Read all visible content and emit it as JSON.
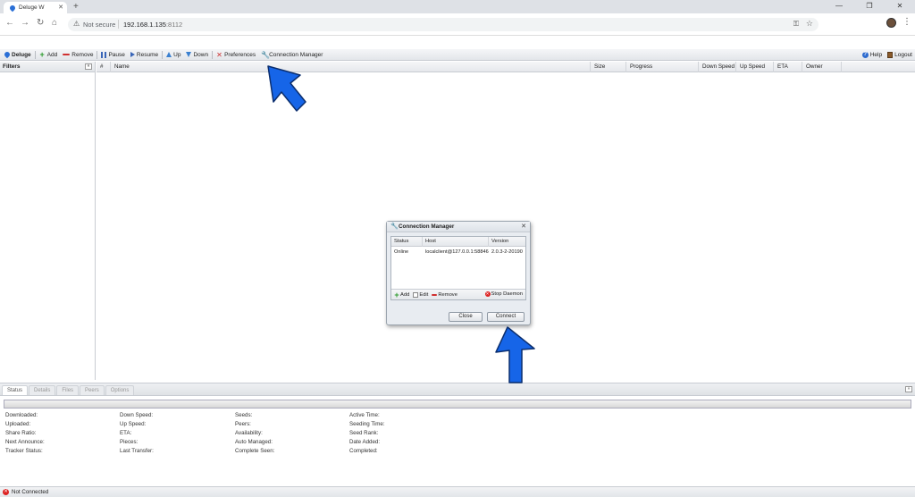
{
  "browser": {
    "tab_title": "Deluge W",
    "security_label": "Not secure",
    "url_host": "192.168.1.135",
    "url_port": ":8112"
  },
  "toolbar": {
    "brand": "Deluge",
    "add": "Add",
    "remove": "Remove",
    "pause": "Pause",
    "resume": "Resume",
    "up": "Up",
    "down": "Down",
    "preferences": "Preferences",
    "connection_manager": "Connection Manager",
    "help": "Help",
    "logout": "Logout"
  },
  "filters": {
    "title": "Filters"
  },
  "grid": {
    "columns": [
      "#",
      "Name",
      "Size",
      "Progress",
      "Down Speed",
      "Up Speed",
      "ETA",
      "Owner"
    ]
  },
  "details": {
    "tabs": [
      "Status",
      "Details",
      "Files",
      "Peers",
      "Options"
    ],
    "active_tab": "Status",
    "fields": [
      [
        "Downloaded:",
        "Uploaded:",
        "Share Ratio:",
        "Next Announce:",
        "Tracker Status:"
      ],
      [
        "Down Speed:",
        "Up Speed:",
        "ETA:",
        "Pieces:",
        "Last Transfer:"
      ],
      [
        "Seeds:",
        "Peers:",
        "Availability:",
        "Auto Managed:",
        "Complete Seen:"
      ],
      [
        "Active Time:",
        "Seeding Time:",
        "Seed Rank:",
        "Date Added:",
        "Completed:"
      ]
    ]
  },
  "status_bar": {
    "text": "Not Connected"
  },
  "dialog": {
    "title": "Connection Manager",
    "columns": [
      "Status",
      "Host",
      "Version"
    ],
    "rows": [
      {
        "status": "Online",
        "host": "localclient@127.0.0.1:58846",
        "version": "2.0.3-2-20190"
      }
    ],
    "add": "Add",
    "edit": "Edit",
    "remove": "Remove",
    "stop_daemon": "Stop Daemon",
    "close": "Close",
    "connect": "Connect"
  },
  "colors": {
    "accent_arrow": "#1665e8",
    "toolbar_bg": "#e3e6ea"
  }
}
